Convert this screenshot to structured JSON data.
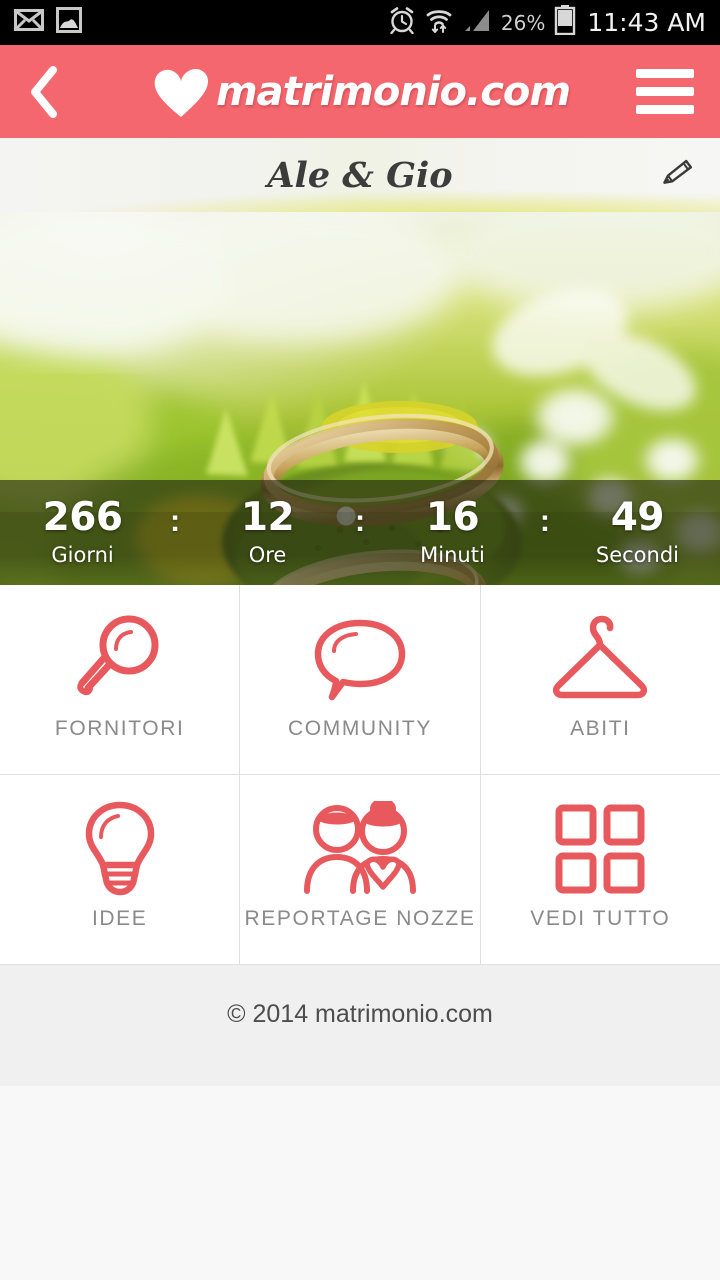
{
  "status_bar": {
    "icons_left": [
      "email-icon",
      "gallery-icon"
    ],
    "icons_right": [
      "alarm-icon",
      "wifi-icon",
      "signal-icon",
      "battery-icon"
    ],
    "battery_percent": "26%",
    "time": "11:43 AM"
  },
  "app_bar": {
    "back_icon": "back-chevron-icon",
    "logo_heart_icon": "heart-icon",
    "logo_text": "matrimonio.com",
    "menu_icon": "hamburger-menu-icon",
    "background_color": "#f4676e"
  },
  "name_bar": {
    "couple_name": "Ale & Gio",
    "edit_icon": "pencil-edit-icon"
  },
  "hero": {
    "image_description": "wedding-rings-on-green-flowers",
    "countdown": {
      "units": [
        {
          "value": "266",
          "label": "Giorni"
        },
        {
          "value": "12",
          "label": "Ore"
        },
        {
          "value": "16",
          "label": "Minuti"
        },
        {
          "value": "49",
          "label": "Secondi"
        }
      ],
      "separator": ":"
    }
  },
  "grid": {
    "tiles": [
      {
        "label": "FORNITORI",
        "icon": "magnifier-icon"
      },
      {
        "label": "COMMUNITY",
        "icon": "speech-bubble-icon"
      },
      {
        "label": "ABITI",
        "icon": "clothes-hanger-icon"
      },
      {
        "label": "IDEE",
        "icon": "lightbulb-icon"
      },
      {
        "label": "REPORTAGE NOZZE",
        "icon": "couple-icon"
      },
      {
        "label": "VEDI TUTTO",
        "icon": "grid-squares-icon"
      }
    ],
    "icon_color": "#e8595e",
    "label_color": "#8a8a8a"
  },
  "footer": {
    "copyright": "© 2014 matrimonio.com"
  }
}
